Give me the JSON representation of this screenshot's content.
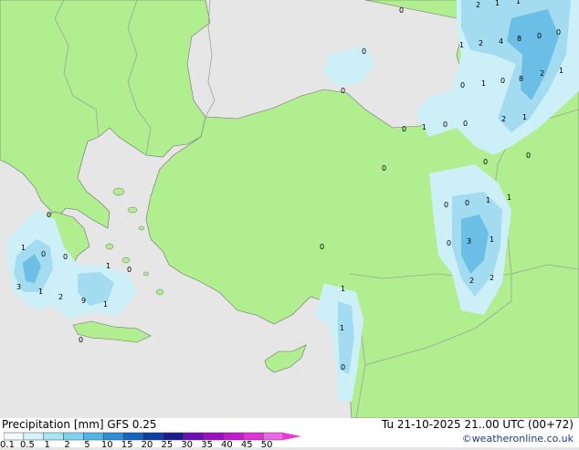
{
  "map": {
    "precip_labels": [
      "2",
      "1",
      "1",
      "0",
      "1",
      "2",
      "4",
      "8",
      "0",
      "0",
      "0",
      "1",
      "0",
      "0",
      "8",
      "2",
      "0",
      "0",
      "1",
      "0",
      "1",
      "2",
      "0",
      "1",
      "0",
      "0",
      "0",
      "0",
      "0",
      "0",
      "0",
      "1",
      "1",
      "0",
      "0",
      "3",
      "1",
      "2",
      "2",
      "1",
      "0",
      "1",
      "1",
      "0",
      "1",
      "0",
      "1",
      "3",
      "1",
      "2",
      "9",
      "1",
      "0"
    ],
    "colors": {
      "sea": "#e6e6e6",
      "land": "#b0ee8f",
      "border": "#9aa59a",
      "coast": "#707070",
      "precip_light": "#cdeff8",
      "precip_mid": "#a3dcf1",
      "precip_strong": "#6bbfe6"
    }
  },
  "footer": {
    "left_title": "Precipitation [mm]  GFS 0.25",
    "right_title": "Tu 21-10-2025 21..00 UTC (00+72)",
    "credit": "©weatheronline.co.uk",
    "scale_ticks": [
      "0.1",
      "0.5",
      "1",
      "2",
      "5",
      "10",
      "15",
      "20",
      "25",
      "30",
      "35",
      "40",
      "45",
      "50"
    ],
    "scale_colors": [
      "#f0fbff",
      "#d4f3fc",
      "#a7e5f6",
      "#7dd3f0",
      "#4fb6e4",
      "#2f8fd4",
      "#1565c0",
      "#0d3fa6",
      "#1a1a8c",
      "#6a0fb3",
      "#9a0fc2",
      "#c21ad0",
      "#dd33d8",
      "#ee66e8"
    ]
  }
}
